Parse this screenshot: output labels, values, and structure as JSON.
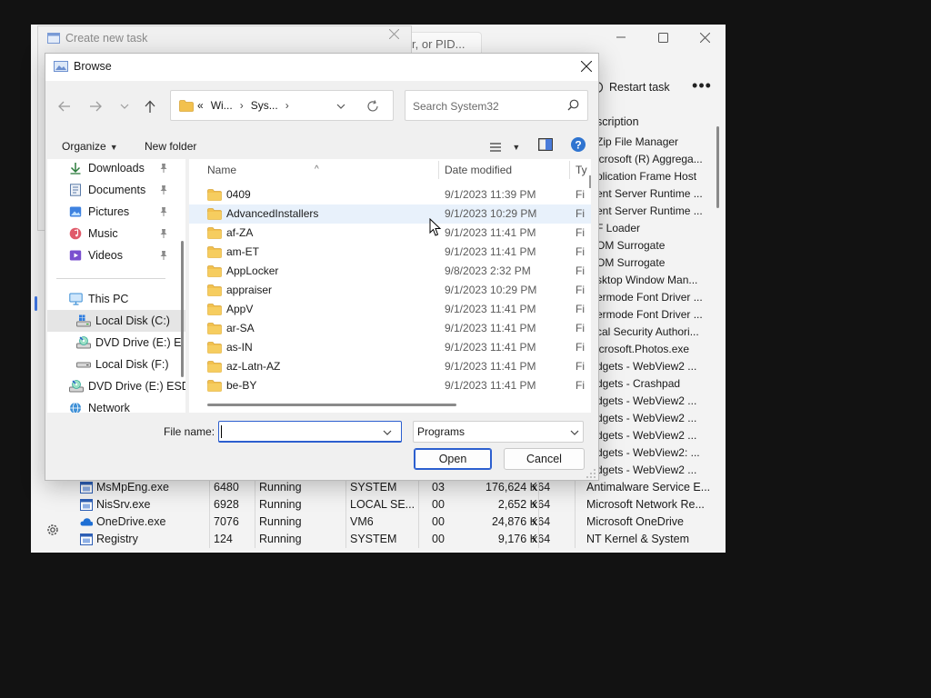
{
  "task_manager": {
    "search_fragment": "r, or PID...",
    "restart_label": "Restart task",
    "more_label": "•••",
    "desc_header": "scription",
    "desc_fragments": [
      "Zip File Manager",
      "icrosoft (R) Aggrega...",
      "plication Frame Host",
      "ent Server Runtime ...",
      "ent Server Runtime ...",
      "F Loader",
      "OM Surrogate",
      "OM Surrogate",
      "sktop Window Man...",
      "ermode Font Driver ...",
      "ermode Font Driver ...",
      "cal Security Authori...",
      "icrosoft.Photos.exe",
      "dgets - WebView2 ...",
      "dgets - Crashpad",
      "dgets - WebView2 ...",
      "dgets - WebView2 ...",
      "dgets - WebView2 ...",
      "dgets - WebView2: ...",
      "dgets - WebView2 ..."
    ],
    "processes": [
      {
        "name": "MsMpEng.exe",
        "pid": "6480",
        "status": "Running",
        "user": "SYSTEM",
        "cpu": "03",
        "memory": "176,624 K",
        "arch": "x64",
        "description": "Antimalware Service E...",
        "icon": "app-window-icon"
      },
      {
        "name": "NisSrv.exe",
        "pid": "6928",
        "status": "Running",
        "user": "LOCAL SE...",
        "cpu": "00",
        "memory": "2,652 K",
        "arch": "x64",
        "description": "Microsoft Network Re...",
        "icon": "app-window-icon"
      },
      {
        "name": "OneDrive.exe",
        "pid": "7076",
        "status": "Running",
        "user": "VM6",
        "cpu": "00",
        "memory": "24,876 K",
        "arch": "x64",
        "description": "Microsoft OneDrive",
        "icon": "onedrive-cloud-icon"
      },
      {
        "name": "Registry",
        "pid": "124",
        "status": "Running",
        "user": "SYSTEM",
        "cpu": "00",
        "memory": "9,176 K",
        "arch": "x64",
        "description": "NT Kernel & System",
        "icon": "app-window-icon"
      }
    ]
  },
  "create_task": {
    "title": "Create new task"
  },
  "browse": {
    "title": "Browse",
    "address": {
      "prefix": "«",
      "crumbs": [
        "Wi...",
        "Sys..."
      ]
    },
    "search_placeholder": "Search System32",
    "organize_label": "Organize",
    "new_folder_label": "New folder",
    "nav_items": [
      {
        "label": "Downloads",
        "icon": "download-arrow-icon",
        "pinned": true
      },
      {
        "label": "Documents",
        "icon": "documents-icon",
        "pinned": true
      },
      {
        "label": "Pictures",
        "icon": "pictures-icon",
        "pinned": true
      },
      {
        "label": "Music",
        "icon": "music-icon",
        "pinned": true
      },
      {
        "label": "Videos",
        "icon": "videos-icon",
        "pinned": true
      },
      {
        "label": "This PC",
        "icon": "monitor-icon"
      },
      {
        "label": "Local Disk (C:)",
        "icon": "windows-drive-icon",
        "selected": true
      },
      {
        "label": "DVD Drive (E:) E",
        "icon": "dvd-drive-icon"
      },
      {
        "label": "Local Disk (F:)",
        "icon": "drive-icon"
      },
      {
        "label": "DVD Drive (E:) ESD",
        "icon": "dvd-drive-icon"
      },
      {
        "label": "Network",
        "icon": "network-icon"
      }
    ],
    "columns": {
      "name": "Name",
      "date": "Date modified",
      "type": "Ty"
    },
    "files": [
      {
        "name": "0409",
        "date": "9/1/2023 11:39 PM",
        "type": "Fi"
      },
      {
        "name": "AdvancedInstallers",
        "date": "9/1/2023 10:29 PM",
        "type": "Fi",
        "hover": true
      },
      {
        "name": "af-ZA",
        "date": "9/1/2023 11:41 PM",
        "type": "Fi"
      },
      {
        "name": "am-ET",
        "date": "9/1/2023 11:41 PM",
        "type": "Fi"
      },
      {
        "name": "AppLocker",
        "date": "9/8/2023 2:32 PM",
        "type": "Fi"
      },
      {
        "name": "appraiser",
        "date": "9/1/2023 10:29 PM",
        "type": "Fi"
      },
      {
        "name": "AppV",
        "date": "9/1/2023 11:41 PM",
        "type": "Fi"
      },
      {
        "name": "ar-SA",
        "date": "9/1/2023 11:41 PM",
        "type": "Fi"
      },
      {
        "name": "as-IN",
        "date": "9/1/2023 11:41 PM",
        "type": "Fi"
      },
      {
        "name": "az-Latn-AZ",
        "date": "9/1/2023 11:41 PM",
        "type": "Fi"
      },
      {
        "name": "be-BY",
        "date": "9/1/2023 11:41 PM",
        "type": "Fi"
      }
    ],
    "file_name_label": "File name:",
    "file_name_value": "",
    "file_type_value": "Programs",
    "open_label": "Open",
    "cancel_label": "Cancel"
  },
  "colors": {
    "accent": "#2c5fcf",
    "folder": "#f2c14e",
    "hover_row": "#e8f1fb",
    "selected_nav": "#e5e5e5"
  }
}
